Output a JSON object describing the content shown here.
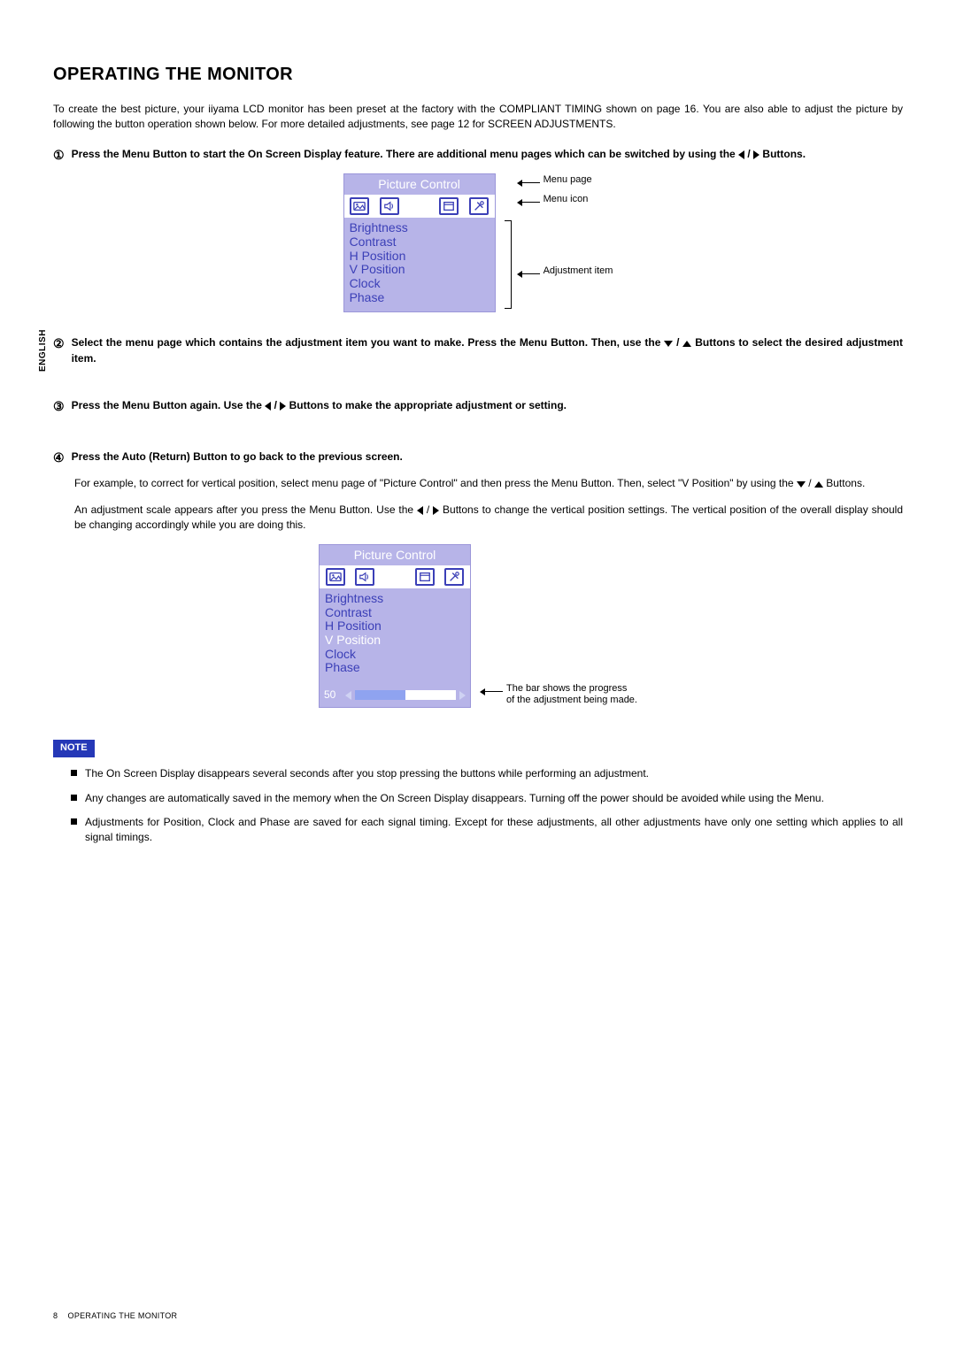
{
  "page": {
    "side_label": "ENGLISH",
    "title": "OPERATING THE MONITOR",
    "intro": "To create the best picture, your iiyama LCD monitor has been preset at the factory with the COMPLIANT TIMING shown on page 16. You are also able to adjust the picture by following the button operation shown below. For more detailed adjustments, see page 12 for SCREEN ADJUSTMENTS.",
    "footer_num": "8",
    "footer_text": "OPERATING THE MONITOR"
  },
  "steps": {
    "s1": {
      "num": "①",
      "pre": "Press the Menu Button to start the On Screen Display feature. There are additional menu pages which can be switched by using the ",
      "mid": " / ",
      "post": " Buttons."
    },
    "s2": {
      "num": "②",
      "pre": "Select the menu page which contains the adjustment item you want to make. Press the Menu Button. Then, use the ",
      "mid": " / ",
      "post": " Buttons to select the desired adjustment item."
    },
    "s3": {
      "num": "③",
      "pre": "Press the Menu Button again. Use the ",
      "mid": " / ",
      "post": " Buttons to make the appropriate adjustment or setting."
    },
    "s4": {
      "num": "④",
      "text": "Press the Auto (Return) Button to go back to the previous screen."
    }
  },
  "example": {
    "p1_pre": "For example, to correct for vertical position, select menu page of \"Picture Control\" and then press the Menu Button. Then, select \"V Position\" by using the ",
    "p1_mid": " / ",
    "p1_post": " Buttons.",
    "p2_pre": "An adjustment scale appears after you press the Menu Button. Use the ",
    "p2_mid": " / ",
    "p2_post": " Buttons to change the vertical position settings. The vertical position of the overall display should be changing accordingly while you are doing this."
  },
  "osd": {
    "title": "Picture Control",
    "items": [
      "Brightness",
      "Contrast",
      "H Position",
      "V Position",
      "Clock",
      "Phase"
    ],
    "value": "50",
    "anno_menu_page": "Menu page",
    "anno_menu_icon": "Menu icon",
    "anno_adjust_item": "Adjustment item",
    "anno_bar_l1": "The bar shows the progress",
    "anno_bar_l2": "of the adjustment being made."
  },
  "note": {
    "label": "NOTE",
    "n1": "The On Screen Display disappears several seconds after you stop pressing the buttons while performing an adjustment.",
    "n2": "Any changes are automatically saved in the memory when the On Screen Display disappears. Turning off the power should be avoided while using the Menu.",
    "n3": "Adjustments for Position, Clock and Phase are saved for each signal timing. Except for these adjustments, all other adjustments have only one setting which applies to all signal timings."
  }
}
